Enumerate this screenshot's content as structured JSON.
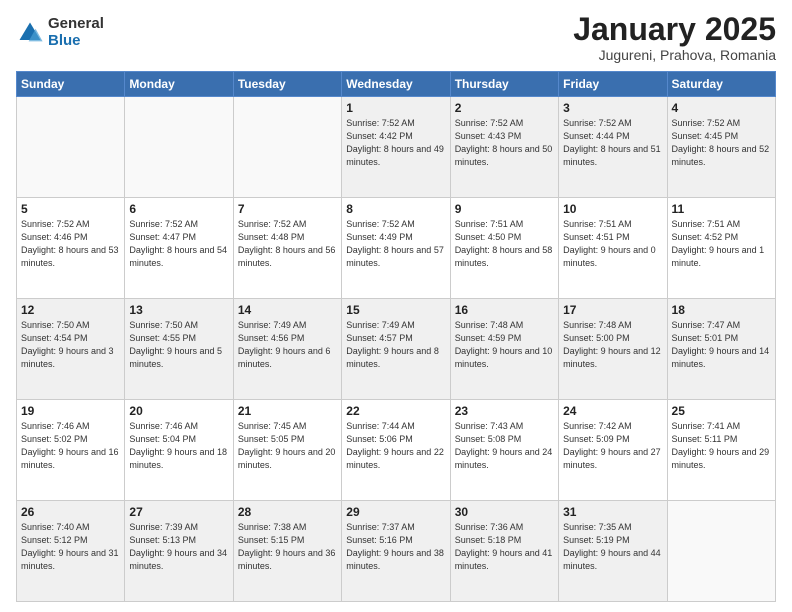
{
  "logo": {
    "general": "General",
    "blue": "Blue"
  },
  "header": {
    "month": "January 2025",
    "location": "Jugureni, Prahova, Romania"
  },
  "weekdays": [
    "Sunday",
    "Monday",
    "Tuesday",
    "Wednesday",
    "Thursday",
    "Friday",
    "Saturday"
  ],
  "weeks": [
    [
      {
        "day": "",
        "empty": true
      },
      {
        "day": "",
        "empty": true
      },
      {
        "day": "",
        "empty": true
      },
      {
        "day": "1",
        "sunrise": "7:52 AM",
        "sunset": "4:42 PM",
        "daylight": "8 hours and 49 minutes."
      },
      {
        "day": "2",
        "sunrise": "7:52 AM",
        "sunset": "4:43 PM",
        "daylight": "8 hours and 50 minutes."
      },
      {
        "day": "3",
        "sunrise": "7:52 AM",
        "sunset": "4:44 PM",
        "daylight": "8 hours and 51 minutes."
      },
      {
        "day": "4",
        "sunrise": "7:52 AM",
        "sunset": "4:45 PM",
        "daylight": "8 hours and 52 minutes."
      }
    ],
    [
      {
        "day": "5",
        "sunrise": "7:52 AM",
        "sunset": "4:46 PM",
        "daylight": "8 hours and 53 minutes."
      },
      {
        "day": "6",
        "sunrise": "7:52 AM",
        "sunset": "4:47 PM",
        "daylight": "8 hours and 54 minutes."
      },
      {
        "day": "7",
        "sunrise": "7:52 AM",
        "sunset": "4:48 PM",
        "daylight": "8 hours and 56 minutes."
      },
      {
        "day": "8",
        "sunrise": "7:52 AM",
        "sunset": "4:49 PM",
        "daylight": "8 hours and 57 minutes."
      },
      {
        "day": "9",
        "sunrise": "7:51 AM",
        "sunset": "4:50 PM",
        "daylight": "8 hours and 58 minutes."
      },
      {
        "day": "10",
        "sunrise": "7:51 AM",
        "sunset": "4:51 PM",
        "daylight": "9 hours and 0 minutes."
      },
      {
        "day": "11",
        "sunrise": "7:51 AM",
        "sunset": "4:52 PM",
        "daylight": "9 hours and 1 minute."
      }
    ],
    [
      {
        "day": "12",
        "sunrise": "7:50 AM",
        "sunset": "4:54 PM",
        "daylight": "9 hours and 3 minutes."
      },
      {
        "day": "13",
        "sunrise": "7:50 AM",
        "sunset": "4:55 PM",
        "daylight": "9 hours and 5 minutes."
      },
      {
        "day": "14",
        "sunrise": "7:49 AM",
        "sunset": "4:56 PM",
        "daylight": "9 hours and 6 minutes."
      },
      {
        "day": "15",
        "sunrise": "7:49 AM",
        "sunset": "4:57 PM",
        "daylight": "9 hours and 8 minutes."
      },
      {
        "day": "16",
        "sunrise": "7:48 AM",
        "sunset": "4:59 PM",
        "daylight": "9 hours and 10 minutes."
      },
      {
        "day": "17",
        "sunrise": "7:48 AM",
        "sunset": "5:00 PM",
        "daylight": "9 hours and 12 minutes."
      },
      {
        "day": "18",
        "sunrise": "7:47 AM",
        "sunset": "5:01 PM",
        "daylight": "9 hours and 14 minutes."
      }
    ],
    [
      {
        "day": "19",
        "sunrise": "7:46 AM",
        "sunset": "5:02 PM",
        "daylight": "9 hours and 16 minutes."
      },
      {
        "day": "20",
        "sunrise": "7:46 AM",
        "sunset": "5:04 PM",
        "daylight": "9 hours and 18 minutes."
      },
      {
        "day": "21",
        "sunrise": "7:45 AM",
        "sunset": "5:05 PM",
        "daylight": "9 hours and 20 minutes."
      },
      {
        "day": "22",
        "sunrise": "7:44 AM",
        "sunset": "5:06 PM",
        "daylight": "9 hours and 22 minutes."
      },
      {
        "day": "23",
        "sunrise": "7:43 AM",
        "sunset": "5:08 PM",
        "daylight": "9 hours and 24 minutes."
      },
      {
        "day": "24",
        "sunrise": "7:42 AM",
        "sunset": "5:09 PM",
        "daylight": "9 hours and 27 minutes."
      },
      {
        "day": "25",
        "sunrise": "7:41 AM",
        "sunset": "5:11 PM",
        "daylight": "9 hours and 29 minutes."
      }
    ],
    [
      {
        "day": "26",
        "sunrise": "7:40 AM",
        "sunset": "5:12 PM",
        "daylight": "9 hours and 31 minutes."
      },
      {
        "day": "27",
        "sunrise": "7:39 AM",
        "sunset": "5:13 PM",
        "daylight": "9 hours and 34 minutes."
      },
      {
        "day": "28",
        "sunrise": "7:38 AM",
        "sunset": "5:15 PM",
        "daylight": "9 hours and 36 minutes."
      },
      {
        "day": "29",
        "sunrise": "7:37 AM",
        "sunset": "5:16 PM",
        "daylight": "9 hours and 38 minutes."
      },
      {
        "day": "30",
        "sunrise": "7:36 AM",
        "sunset": "5:18 PM",
        "daylight": "9 hours and 41 minutes."
      },
      {
        "day": "31",
        "sunrise": "7:35 AM",
        "sunset": "5:19 PM",
        "daylight": "9 hours and 44 minutes."
      },
      {
        "day": "",
        "empty": true
      }
    ]
  ]
}
